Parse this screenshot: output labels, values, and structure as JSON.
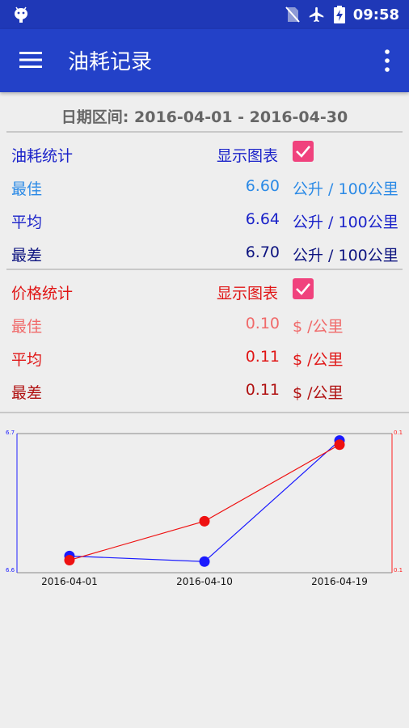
{
  "status": {
    "time": "09:58"
  },
  "appbar": {
    "title": "油耗记录"
  },
  "date_range": "日期区间: 2016-04-01 - 2016-04-30",
  "fuel": {
    "header": "油耗统计",
    "show_chart": "显示图表",
    "show_chart_checked": true,
    "best": {
      "label": "最佳",
      "value": "6.60",
      "unit": "公升 / 100公里"
    },
    "avg": {
      "label": "平均",
      "value": "6.64",
      "unit": "公升 / 100公里"
    },
    "worst": {
      "label": "最差",
      "value": "6.70",
      "unit": "公升 / 100公里"
    },
    "colors": {
      "header": "#1a22c9",
      "best": "#2b8ae6",
      "avg": "#1a22c9",
      "worst": "#0d1480"
    }
  },
  "price": {
    "header": "价格统计",
    "show_chart": "显示图表",
    "show_chart_checked": true,
    "best": {
      "label": "最佳",
      "value": "0.10",
      "unit": "$ /公里"
    },
    "avg": {
      "label": "平均",
      "value": "0.11",
      "unit": "$ /公里"
    },
    "worst": {
      "label": "最差",
      "value": "0.11",
      "unit": "$ /公里"
    },
    "colors": {
      "header": "#e01515",
      "best": "#f06a6a",
      "avg": "#e01515",
      "worst": "#b01010"
    }
  },
  "chart_data": {
    "type": "line",
    "x": [
      "2016-04-01",
      "2016-04-10",
      "2016-04-19"
    ],
    "left_axis": {
      "min_label": "6.6",
      "max_label": "6.7",
      "min": 6.6,
      "max": 6.7,
      "color": "#2020ff"
    },
    "right_axis": {
      "min_label": "0.1",
      "max_label": "0.1",
      "min": 0.1,
      "max": 0.11,
      "color": "#ff2020"
    },
    "series": [
      {
        "axis": "left",
        "color": "#1a1aff",
        "x": [
          0,
          9,
          18
        ],
        "values": [
          6.612,
          6.608,
          6.695
        ]
      },
      {
        "axis": "right",
        "color": "#ee1111",
        "x": [
          0,
          9,
          18
        ],
        "values": [
          0.1009,
          0.1037,
          0.1092
        ]
      }
    ],
    "xrange": [
      -3.5,
      21.5
    ]
  }
}
